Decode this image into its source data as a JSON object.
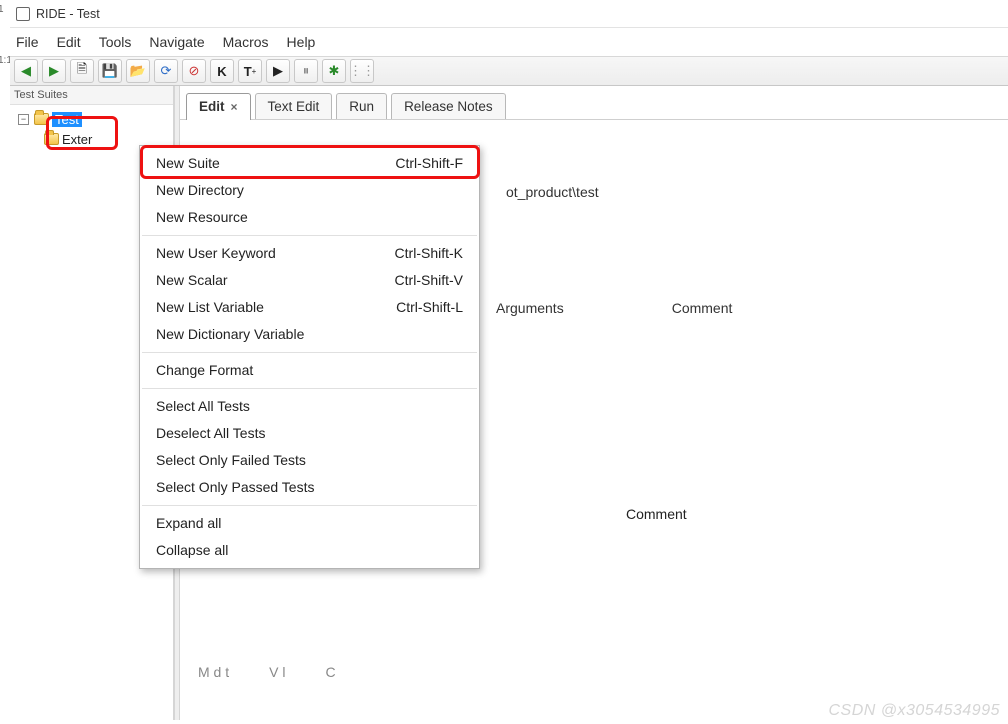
{
  "window": {
    "title": "RIDE - Test"
  },
  "left_line_nums": [
    "1",
    "1:1"
  ],
  "menubar": [
    "File",
    "Edit",
    "Tools",
    "Navigate",
    "Macros",
    "Help"
  ],
  "toolbar_icons": [
    "back",
    "forward",
    "new",
    "save",
    "open",
    "reload",
    "stop",
    "K",
    "T",
    "play",
    "pause",
    "bug",
    "grip"
  ],
  "tree": {
    "header": "Test Suites",
    "nodes": [
      {
        "label": "Test",
        "selected": true
      },
      {
        "label": "Exter",
        "selected": false
      }
    ]
  },
  "tabs": [
    {
      "label": "Edit",
      "active": true,
      "closable": true
    },
    {
      "label": "Text Edit",
      "active": false
    },
    {
      "label": "Run",
      "active": false
    },
    {
      "label": "Release Notes",
      "active": false
    }
  ],
  "panel": {
    "source_fragment": "ot_product\\test",
    "headers": [
      "Arguments",
      "Comment"
    ],
    "comment2": "Comment",
    "bottom_tabs": [
      "M   d  t",
      "V  l",
      "C"
    ]
  },
  "context_menu": {
    "groups": [
      [
        {
          "label": "New Suite",
          "shortcut": "Ctrl-Shift-F"
        },
        {
          "label": "New Directory",
          "shortcut": ""
        },
        {
          "label": "New Resource",
          "shortcut": ""
        }
      ],
      [
        {
          "label": "New User Keyword",
          "shortcut": "Ctrl-Shift-K"
        },
        {
          "label": "New Scalar",
          "shortcut": "Ctrl-Shift-V"
        },
        {
          "label": "New List Variable",
          "shortcut": "Ctrl-Shift-L"
        },
        {
          "label": "New Dictionary Variable",
          "shortcut": ""
        }
      ],
      [
        {
          "label": "Change Format",
          "shortcut": ""
        }
      ],
      [
        {
          "label": "Select All Tests",
          "shortcut": ""
        },
        {
          "label": "Deselect All Tests",
          "shortcut": ""
        },
        {
          "label": "Select Only Failed Tests",
          "shortcut": ""
        },
        {
          "label": "Select Only Passed Tests",
          "shortcut": ""
        }
      ],
      [
        {
          "label": "Expand all",
          "shortcut": ""
        },
        {
          "label": "Collapse all",
          "shortcut": ""
        }
      ]
    ]
  },
  "watermark": "CSDN @x3054534995"
}
